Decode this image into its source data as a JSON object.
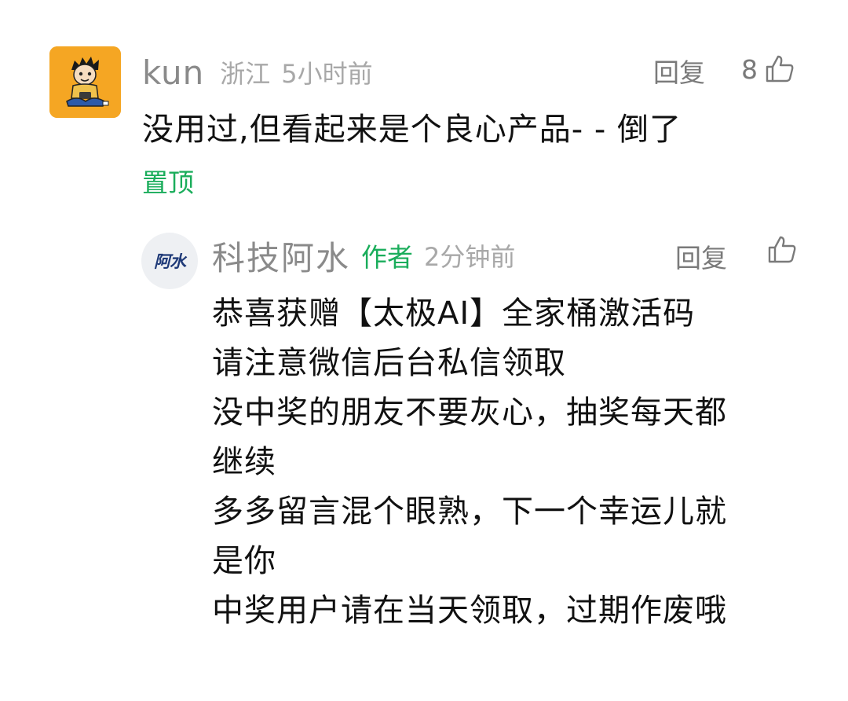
{
  "comment": {
    "username": "kun",
    "location": "浙江",
    "time": "5小时前",
    "reply_label": "回复",
    "like_count": "8",
    "text": "没用过,但看起来是个良心产品- - 倒了",
    "pin_label": "置顶",
    "avatar_icon": "cartoon-boy-avatar",
    "avatar_color": "#f5a623"
  },
  "reply": {
    "avatar_text": "阿水",
    "username": "科技阿水",
    "author_tag": "作者",
    "time": "2分钟前",
    "reply_label": "回复",
    "lines": [
      "恭喜获赠【太极AI】全家桶激活码",
      "请注意微信后台私信领取",
      "没中奖的朋友不要灰心，抽奖每天都",
      "继续",
      "多多留言混个眼熟，下一个幸运儿就",
      "是你",
      "中奖用户请在当天领取，过期作废哦"
    ]
  },
  "colors": {
    "accent_green": "#1aad5b",
    "meta_gray": "#a8a8a8",
    "name_gray": "#8a8a8a"
  }
}
